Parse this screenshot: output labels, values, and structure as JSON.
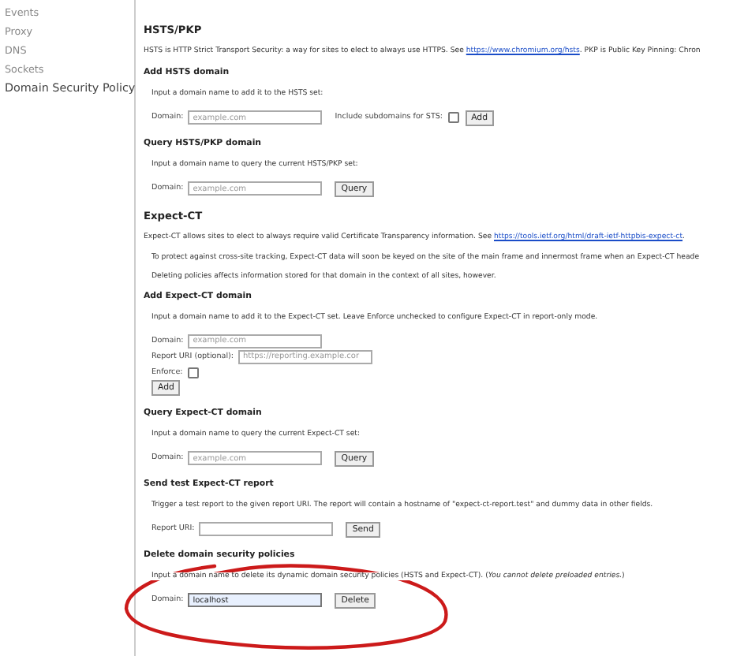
{
  "sidebar": {
    "items": [
      {
        "label": "Events",
        "selected": false
      },
      {
        "label": "Proxy",
        "selected": false
      },
      {
        "label": "DNS",
        "selected": false
      },
      {
        "label": "Sockets",
        "selected": false
      },
      {
        "label": "Domain Security Policy",
        "selected": true
      }
    ]
  },
  "blocks": [
    {
      "kind": "heading",
      "text": "HSTS/PKP"
    },
    {
      "kind": "text",
      "text": "HSTS is HTTP Strict Transport Security: a way for sites to elect to always use HTTPS. See ",
      "link": "https://www.chromium.org/hsts",
      "after": ". PKP is Public Key Pinning: Chron"
    },
    {
      "kind": "subheading",
      "text": "Add HSTS domain"
    },
    {
      "kind": "note",
      "text": "Input a domain name to add it to the HSTS set:"
    },
    {
      "kind": "form",
      "lines": [
        [
          {
            "kind": "label",
            "text": "Domain:"
          },
          {
            "kind": "input",
            "placeholder": "example.com"
          },
          {
            "kind": "label",
            "text": "Include subdomains for STS:"
          },
          {
            "kind": "checkbox",
            "checked": false
          },
          {
            "kind": "button",
            "text": "Add"
          }
        ]
      ]
    },
    {
      "kind": "subheading",
      "text": "Query HSTS/PKP domain"
    },
    {
      "kind": "note",
      "text": "Input a domain name to query the current HSTS/PKP set:"
    },
    {
      "kind": "form",
      "lines": [
        [
          {
            "kind": "label",
            "text": "Domain:"
          },
          {
            "kind": "input",
            "placeholder": "example.com"
          },
          {
            "kind": "button",
            "text": "Query"
          }
        ]
      ]
    },
    {
      "kind": "heading",
      "text": "Expect-CT"
    },
    {
      "kind": "text",
      "text": "Expect-CT allows sites to elect to always require valid Certificate Transparency information. See ",
      "link": "https://tools.ietf.org/html/draft-ietf-httpbis-expect-ct",
      "after": "."
    },
    {
      "kind": "note",
      "text": "To protect against cross-site tracking, Expect-CT data will soon be keyed on the site of the main frame and innermost frame when an Expect-CT heade"
    },
    {
      "kind": "note",
      "text": "Deleting policies affects information stored for that domain in the context of all sites, however."
    },
    {
      "kind": "subheading",
      "text": "Add Expect-CT domain"
    },
    {
      "kind": "note",
      "text": "Input a domain name to add it to the Expect-CT set. Leave Enforce unchecked to configure Expect-CT in report-only mode."
    },
    {
      "kind": "form",
      "lines": [
        [
          {
            "kind": "label",
            "text": "Domain:"
          },
          {
            "kind": "input",
            "placeholder": "example.com"
          }
        ],
        [
          {
            "kind": "label",
            "text": "Report URI (optional):"
          },
          {
            "kind": "input",
            "placeholder": "https://reporting.example.cor"
          }
        ],
        [
          {
            "kind": "label",
            "text": "Enforce:"
          },
          {
            "kind": "checkbox",
            "checked": false
          }
        ],
        [
          {
            "kind": "button",
            "text": "Add"
          }
        ]
      ]
    },
    {
      "kind": "subheading",
      "text": "Query Expect-CT domain"
    },
    {
      "kind": "note",
      "text": "Input a domain name to query the current Expect-CT set:"
    },
    {
      "kind": "form",
      "lines": [
        [
          {
            "kind": "label",
            "text": "Domain:"
          },
          {
            "kind": "input",
            "placeholder": "example.com"
          },
          {
            "kind": "button",
            "text": "Query"
          }
        ]
      ]
    },
    {
      "kind": "subheading",
      "text": "Send test Expect-CT report"
    },
    {
      "kind": "note",
      "text": "Trigger a test report to the given report URI. The report will contain a hostname of \"expect-ct-report.test\" and dummy data in other fields."
    },
    {
      "kind": "form",
      "lines": [
        [
          {
            "kind": "label",
            "text": "Report URI:"
          },
          {
            "kind": "input"
          },
          {
            "kind": "button",
            "text": "Send"
          }
        ]
      ]
    },
    {
      "kind": "subheading",
      "text": "Delete domain security policies"
    },
    {
      "kind": "note",
      "text": "Input a domain name to delete its dynamic domain security policies (HSTS and Expect-CT). (*You cannot delete preloaded entries.*)"
    },
    {
      "kind": "form",
      "lines": [
        [
          {
            "kind": "label",
            "text": "Domain:"
          },
          {
            "kind": "input",
            "value": "localhost",
            "focused": true
          },
          {
            "kind": "button",
            "text": "Delete"
          }
        ]
      ]
    }
  ],
  "annotation": {
    "kind": "ellipse",
    "color": "#cc1a1a"
  }
}
